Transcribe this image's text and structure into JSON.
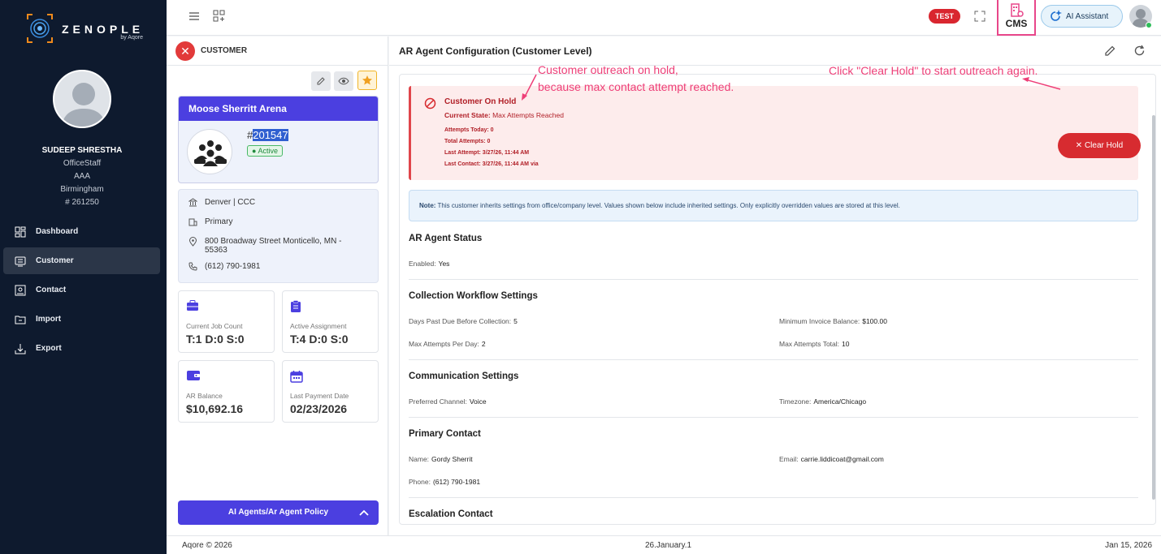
{
  "brand": {
    "name": "ZENOPLE",
    "by": "by Aqore"
  },
  "user": {
    "name": "SUDEEP SHRESTHA",
    "role": "OfficeStaff",
    "company": "AAA",
    "city": "Birmingham",
    "id": "# 261250"
  },
  "nav": [
    {
      "label": "Dashboard",
      "icon": "dashboard-icon"
    },
    {
      "label": "Customer",
      "icon": "customer-icon",
      "active": true
    },
    {
      "label": "Contact",
      "icon": "contact-icon"
    },
    {
      "label": "Import",
      "icon": "import-icon"
    },
    {
      "label": "Export",
      "icon": "export-icon"
    }
  ],
  "topbar": {
    "env_badge": "TEST",
    "cms_label": "CMS",
    "ai_label": "AI Assistant"
  },
  "customer_panel": {
    "header": "CUSTOMER",
    "name": "Moose Sherritt Arena",
    "number_prefix": "#",
    "number": "201547",
    "status": "Active",
    "office": "Denver | CCC",
    "address_type": "Primary",
    "address_line1": "800 Broadway Street Monticello, MN -",
    "address_line2": "55363",
    "phone": "(612) 790-1981",
    "stats": [
      {
        "label": "Current Job Count",
        "value": "T:1 D:0 S:0"
      },
      {
        "label": "Active Assignment",
        "value": "T:4 D:0 S:0"
      },
      {
        "label": "AR Balance",
        "value": "$10,692.16"
      },
      {
        "label": "Last Payment Date",
        "value": "02/23/2026"
      }
    ],
    "policy_button": "AI Agents/Ar Agent Policy"
  },
  "main": {
    "title": "AR Agent Configuration (Customer Level)",
    "hold": {
      "title": "Customer On Hold",
      "state_label": "Current State:",
      "state_value": "Max Attempts Reached",
      "attempts_today": "Attempts Today: 0",
      "total_attempts": "Total Attempts: 0",
      "last_attempt": "Last Attempt: 3/27/26, 11:44 AM",
      "last_contact": "Last Contact: 3/27/26, 11:44 AM via",
      "clear_button": "Clear Hold"
    },
    "note_label": "Note:",
    "note_text": "This customer inherits settings from office/company level. Values shown below include inherited settings. Only explicitly overridden values are stored at this level.",
    "sections": {
      "ar_status": {
        "title": "AR Agent Status",
        "enabled_label": "Enabled:",
        "enabled_value": "Yes"
      },
      "workflow": {
        "title": "Collection Workflow Settings",
        "days_label": "Days Past Due Before Collection:",
        "days_value": "5",
        "min_label": "Minimum Invoice Balance:",
        "min_value": "$100.00",
        "per_day_label": "Max Attempts Per Day:",
        "per_day_value": "2",
        "total_label": "Max Attempts Total:",
        "total_value": "10"
      },
      "communication": {
        "title": "Communication Settings",
        "channel_label": "Preferred Channel:",
        "channel_value": "Voice",
        "tz_label": "Timezone:",
        "tz_value": "America/Chicago"
      },
      "primary_contact": {
        "title": "Primary Contact",
        "name_label": "Name:",
        "name_value": "Gordy Sherrit",
        "email_label": "Email:",
        "email_value": "carrie.liddicoat@gmail.com",
        "phone_label": "Phone:",
        "phone_value": "(612) 790-1981"
      },
      "escalation": {
        "title": "Escalation Contact"
      }
    }
  },
  "annotations": {
    "hold_line1": "Customer outreach on hold,",
    "hold_line2": "because max contact attempt reached.",
    "clear_hint": "Click \"Clear Hold\" to start outreach again."
  },
  "footer": {
    "copyright": "Aqore © 2026",
    "version": "26.January.1",
    "date": "Jan 15, 2026"
  },
  "colors": {
    "sidebar": "#0e1a2e",
    "accent": "#4b3fe0",
    "danger": "#d72b30",
    "annotation": "#ee3f78"
  }
}
